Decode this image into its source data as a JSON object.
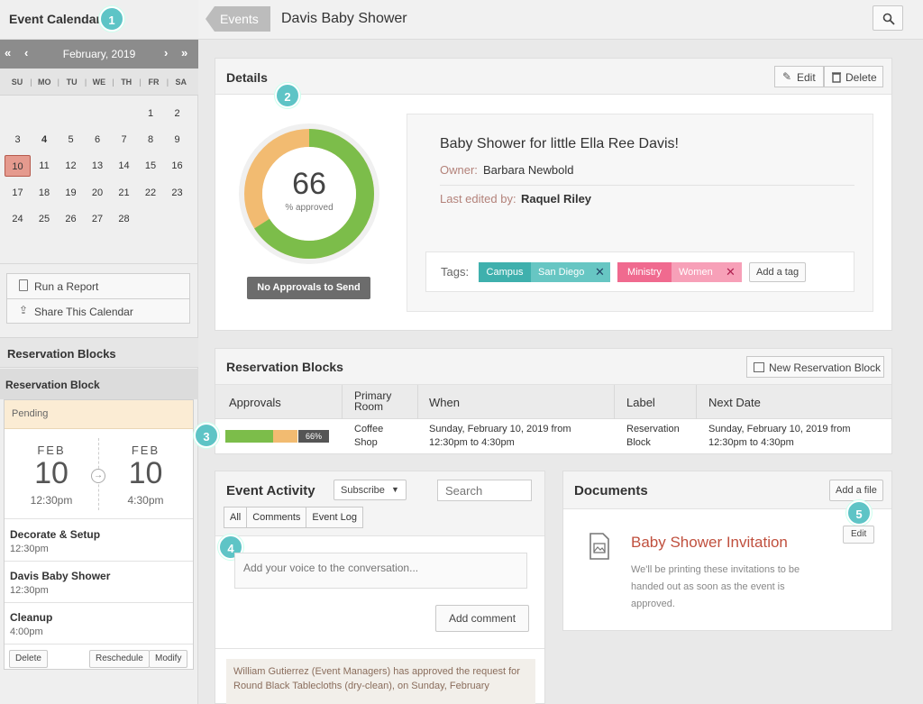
{
  "sidebar": {
    "title": "Event Calendar",
    "badge1": "1",
    "calendar": {
      "month": "February, 2019",
      "dow": [
        "SU",
        "MO",
        "TU",
        "WE",
        "TH",
        "FR",
        "SA"
      ],
      "weeks": [
        [
          "",
          "",
          "",
          "",
          "",
          "1",
          "2"
        ],
        [
          "3",
          "4",
          "5",
          "6",
          "7",
          "8",
          "9"
        ],
        [
          "10",
          "11",
          "12",
          "13",
          "14",
          "15",
          "16"
        ],
        [
          "17",
          "18",
          "19",
          "20",
          "21",
          "22",
          "23"
        ],
        [
          "24",
          "25",
          "26",
          "27",
          "28",
          "",
          ""
        ]
      ]
    },
    "actions": [
      "Run a Report",
      "Share This Calendar"
    ],
    "section_title": "Reservation Blocks",
    "block_title": "Reservation Block",
    "block_status": "Pending",
    "start": {
      "month": "FEB",
      "day": "10",
      "time": "12:30pm"
    },
    "end": {
      "month": "FEB",
      "day": "10",
      "time": "4:30pm"
    },
    "items": [
      {
        "title": "Decorate & Setup",
        "time": "12:30pm"
      },
      {
        "title": "Davis Baby Shower",
        "time": "12:30pm"
      },
      {
        "title": "Cleanup",
        "time": "4:00pm"
      }
    ],
    "footer_buttons": {
      "delete": "Delete",
      "reschedule": "Reschedule",
      "modify": "Modify"
    }
  },
  "topbar": {
    "breadcrumb": "Events",
    "title": "Davis Baby Shower"
  },
  "details": {
    "title": "Details",
    "badge2": "2",
    "edit": "Edit",
    "delete": "Delete",
    "approved_value": 66,
    "approved_number": "66",
    "approved_label": "% approved",
    "no_approvals": "No Approvals to Send",
    "event_name": "Baby Shower for little Ella Ree Davis!",
    "owner_label": "Owner:",
    "owner": "Barbara Newbold",
    "edited_label": "Last edited by:",
    "edited_by": "Raquel Riley",
    "tags_label": "Tags:",
    "tags": [
      {
        "key": "Campus",
        "value": "San Diego",
        "color": "#3fb0ad",
        "light": "#67c6c3"
      },
      {
        "key": "Ministry",
        "value": "Women",
        "color": "#f06a8f",
        "light": "#f7a0b8"
      }
    ],
    "add_tag": "Add a tag",
    "colors": {
      "approved": "#7cbd4a",
      "pending": "#f2bb71"
    }
  },
  "reservations": {
    "title": "Reservation Blocks",
    "new_button": "New Reservation Block",
    "badge3": "3",
    "columns": [
      "Approvals",
      "Primary Room",
      "When",
      "Label",
      "Next Date"
    ],
    "row": {
      "approval_pct": "66%",
      "approval_value": 66,
      "room": "Coffee Shop",
      "when": "Sunday, February 10, 2019 from 12:30pm to 4:30pm",
      "label": "Reservation Block",
      "next_date": "Sunday, February 10, 2019 from 12:30pm to 4:30pm"
    }
  },
  "activity": {
    "title": "Event Activity",
    "subscribe": "Subscribe",
    "search_placeholder": "Search",
    "tabs": [
      "All",
      "Comments",
      "Event Log"
    ],
    "badge4": "4",
    "comment_placeholder": "Add your voice to the conversation...",
    "add_comment": "Add comment",
    "log_entry": "William Gutierrez (Event Managers) has approved the request for Round Black Tablecloths (dry-clean), on Sunday, February"
  },
  "documents": {
    "title": "Documents",
    "add_file": "Add a file",
    "badge5": "5",
    "edit": "Edit",
    "doc_title": "Baby Shower Invitation",
    "doc_desc": "We'll be printing these invitations to be handed out as soon as the event is approved."
  }
}
